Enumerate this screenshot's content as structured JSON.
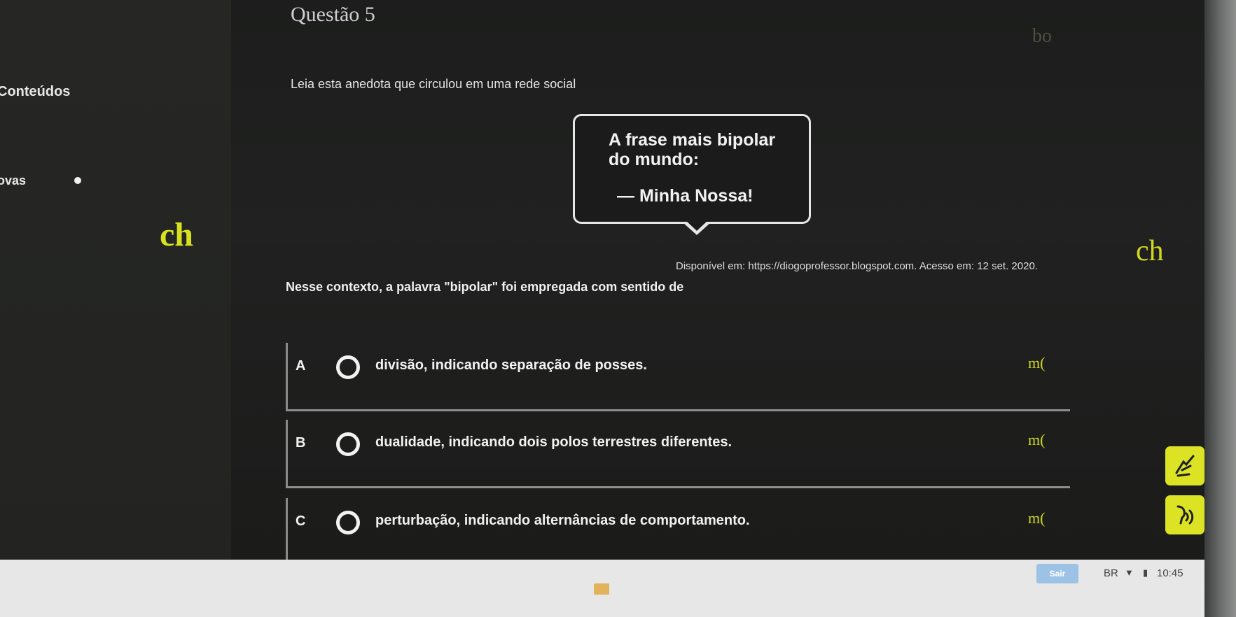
{
  "sidebar": {
    "items": [
      {
        "label": "Conteúdos"
      },
      {
        "label": "ovas"
      }
    ]
  },
  "question": {
    "title": "Questão 5",
    "intro": "Leia esta anedota que circulou em uma rede social",
    "bubble": {
      "line1": "A frase mais bipolar",
      "line2": "do mundo:",
      "line3": "— Minha Nossa!"
    },
    "source": "Disponível em: https://diogoprofessor.blogspot.com. Acesso em: 12 set. 2020.",
    "prompt": "Nesse contexto, a palavra \"bipolar\" foi empregada com sentido de",
    "options": [
      {
        "letter": "A",
        "text": "divisão, indicando separação de posses.",
        "mark": "m("
      },
      {
        "letter": "B",
        "text": "dualidade, indicando dois polos terrestres diferentes.",
        "mark": "m("
      },
      {
        "letter": "C",
        "text": "perturbação, indicando alternâncias de comportamento.",
        "mark": "m("
      }
    ]
  },
  "overlay_marks": {
    "left": "ch",
    "right": "ch",
    "top_right": "bo"
  },
  "side_tools": [
    {
      "icon": "sign-language-icon"
    },
    {
      "icon": "audio-speak-icon"
    }
  ],
  "taskbar": {
    "exit_label": "Sair",
    "lang": "BR",
    "time": "10:45"
  },
  "colors": {
    "accent_yellow": "#dbe324",
    "background": "#1c1d1c",
    "text": "#f1f1f1"
  }
}
